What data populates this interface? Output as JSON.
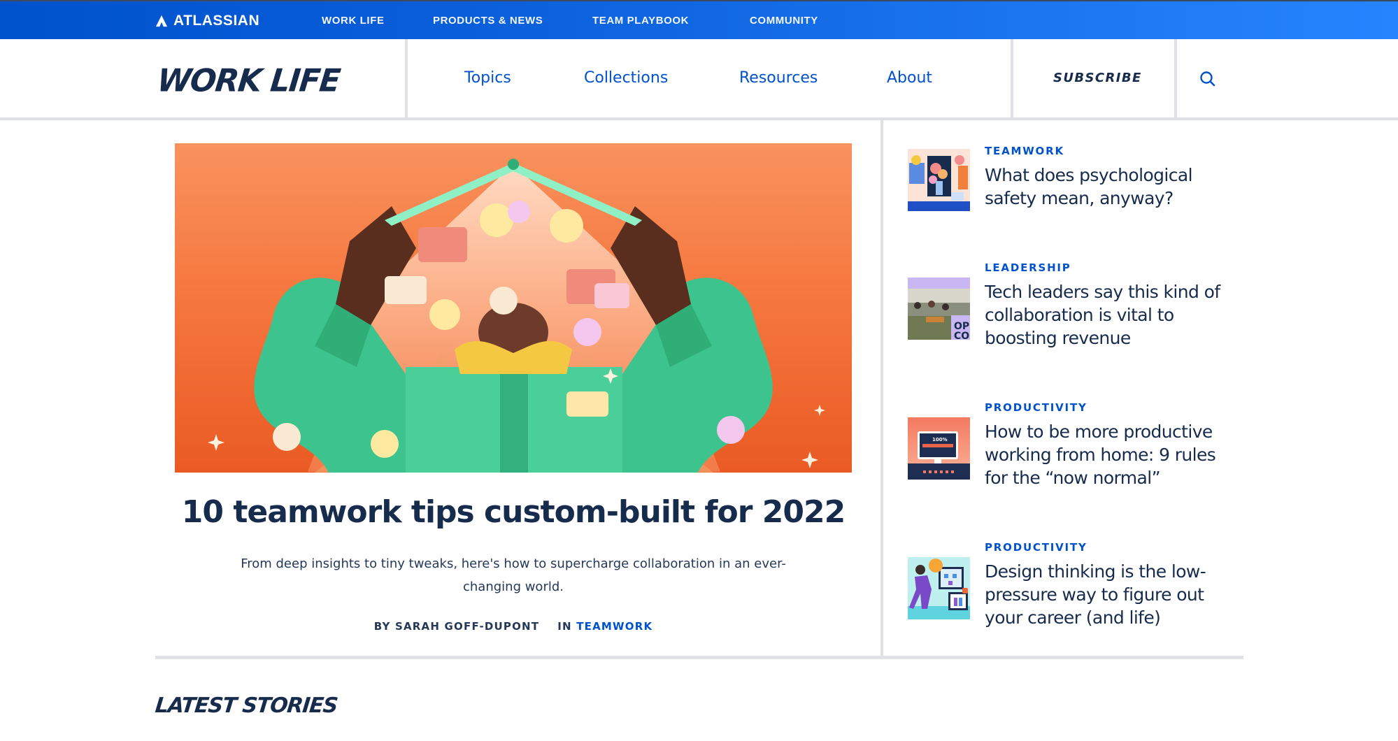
{
  "global_nav": {
    "brand": "ATLASSIAN",
    "items": [
      {
        "label": "WORK LIFE"
      },
      {
        "label": "PRODUCTS & NEWS"
      },
      {
        "label": "TEAM PLAYBOOK"
      },
      {
        "label": "COMMUNITY"
      }
    ]
  },
  "section_header": {
    "logo": "WORK LIFE",
    "nav": [
      {
        "label": "Topics"
      },
      {
        "label": "Collections"
      },
      {
        "label": "Resources"
      },
      {
        "label": "About"
      }
    ],
    "subscribe_label": "SUBSCRIBE",
    "search_icon": "search-icon"
  },
  "hero": {
    "image_alt": "Illustration of a person in a green coat holding open a glowing book-like canopy with floating flowers, smiley faces and chat bubbles on an orange background",
    "title": "10 teamwork tips custom-built for 2022",
    "description": "From deep insights to tiny tweaks, here's how to supercharge collaboration in an ever-changing world.",
    "byline_prefix": "BY",
    "author": "SARAH GOFF-DUPONT",
    "in_prefix": "IN",
    "category": "TEAMWORK"
  },
  "sidebar": {
    "stories": [
      {
        "category": "TEAMWORK",
        "title": "What does psychological safety mean, anyway?",
        "thumb": "psych-safety-illustration"
      },
      {
        "category": "LEADERSHIP",
        "title": "Tech leaders say this kind of collaboration is vital to boosting revenue",
        "thumb": "office-photo"
      },
      {
        "category": "PRODUCTIVITY",
        "title": "How to be more productive working from home: 9 rules for the “now normal”",
        "thumb": "monitor-100-percent",
        "thumb_text": "100%"
      },
      {
        "category": "PRODUCTIVITY",
        "title": "Design thinking is the low-pressure way to figure out your career (and life)",
        "thumb": "design-thinking-illustration"
      }
    ]
  },
  "latest": {
    "heading": "LATEST STORIES"
  },
  "colors": {
    "brand_blue": "#0052CC",
    "topbar_gradient_end": "#2684FF",
    "text_dark": "#172B4D",
    "divider": "#DFE1E6",
    "hero_orange": "#F5783F",
    "hero_green": "#3DC38E"
  }
}
